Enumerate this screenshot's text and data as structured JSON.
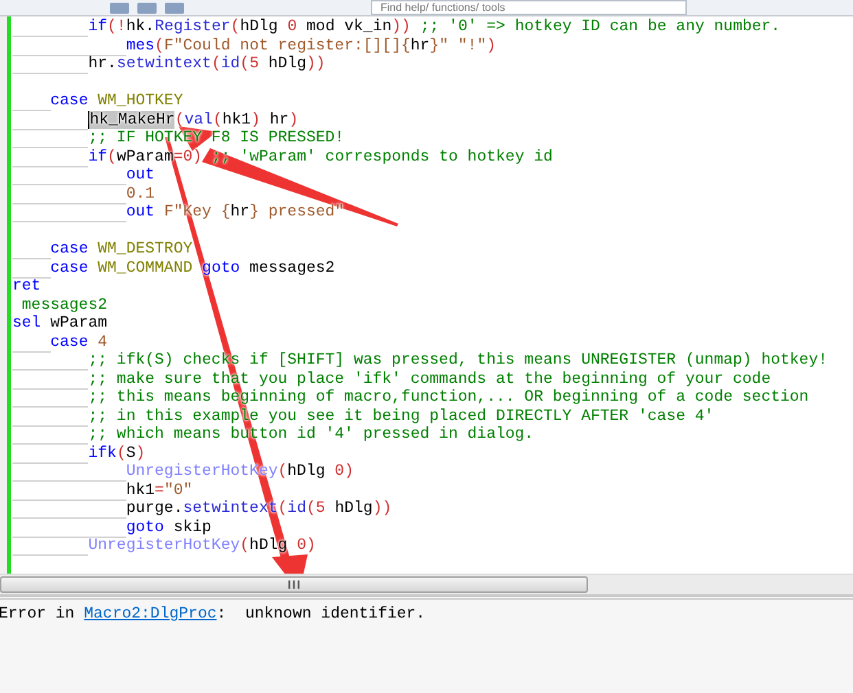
{
  "toolbar": {
    "search": {
      "placeholder": "Find help/ functions/ tools"
    }
  },
  "editor": {
    "lines": [
      {
        "kind": "code",
        "tokens": [
          {
            "text": "\t\tif",
            "kind": "keyword"
          },
          {
            "text": "(!",
            "kind": "op"
          },
          {
            "text": "hk.",
            "kind": "plain"
          },
          {
            "text": "Register",
            "kind": "function"
          },
          {
            "text": "(",
            "kind": "op"
          },
          {
            "text": "hDlg ",
            "kind": "plain"
          },
          {
            "text": "0",
            "kind": "op"
          },
          {
            "text": " mod vk_in",
            "kind": "plain"
          },
          {
            "text": "))",
            "kind": "op"
          },
          {
            "text": " ;; '0' => hotkey ID can be any number.",
            "kind": "comment"
          }
        ]
      },
      {
        "kind": "code",
        "tokens": [
          {
            "text": "\t\t\tmes",
            "kind": "keyword"
          },
          {
            "text": "(",
            "kind": "op"
          },
          {
            "text": "F\"Could not register:[][]{",
            "kind": "string"
          },
          {
            "text": "hr",
            "kind": "plain"
          },
          {
            "text": "}\" \"!\"",
            "kind": "string"
          },
          {
            "text": ")",
            "kind": "op"
          }
        ]
      },
      {
        "kind": "code",
        "tokens": [
          {
            "text": "\t\thr.",
            "kind": "plain"
          },
          {
            "text": "setwintext",
            "kind": "function"
          },
          {
            "text": "(",
            "kind": "op"
          },
          {
            "text": "id",
            "kind": "function"
          },
          {
            "text": "(",
            "kind": "op"
          },
          {
            "text": "5",
            "kind": "op"
          },
          {
            "text": " hDlg",
            "kind": "plain"
          },
          {
            "text": "))",
            "kind": "op"
          }
        ]
      },
      {
        "kind": "blank"
      },
      {
        "kind": "code",
        "tokens": [
          {
            "text": "\tcase",
            "kind": "keyword"
          },
          {
            "text": " WM_HOTKEY",
            "kind": "constant"
          }
        ]
      },
      {
        "kind": "code",
        "tokens": [
          {
            "text": "\t\thk_MakeHr",
            "kind": "selected"
          },
          {
            "text": "(",
            "kind": "op"
          },
          {
            "text": "val",
            "kind": "function"
          },
          {
            "text": "(",
            "kind": "op"
          },
          {
            "text": "hk1",
            "kind": "plain"
          },
          {
            "text": ")",
            "kind": "op"
          },
          {
            "text": " hr",
            "kind": "plain"
          },
          {
            "text": ")",
            "kind": "op"
          }
        ]
      },
      {
        "kind": "code",
        "tokens": [
          {
            "text": "\t\t;; IF HOTKEY F8 IS PRESSED!",
            "kind": "comment"
          }
        ]
      },
      {
        "kind": "code",
        "tokens": [
          {
            "text": "\t\tif",
            "kind": "keyword"
          },
          {
            "text": "(",
            "kind": "op"
          },
          {
            "text": "wParam",
            "kind": "plain"
          },
          {
            "text": "=",
            "kind": "op"
          },
          {
            "text": "0",
            "kind": "op"
          },
          {
            "text": ")",
            "kind": "op"
          },
          {
            "text": " ;; 'wParam' corresponds to hotkey id",
            "kind": "comment"
          }
        ]
      },
      {
        "kind": "code",
        "tokens": [
          {
            "text": "\t\t\tout",
            "kind": "keyword"
          }
        ]
      },
      {
        "kind": "code",
        "tokens": [
          {
            "text": "\t\t\t0.1",
            "kind": "string"
          }
        ]
      },
      {
        "kind": "code",
        "tokens": [
          {
            "text": "\t\t\tout",
            "kind": "keyword"
          },
          {
            "text": " F\"Key {",
            "kind": "string"
          },
          {
            "text": "hr",
            "kind": "plain"
          },
          {
            "text": "} pressed\"",
            "kind": "string"
          }
        ]
      },
      {
        "kind": "blank"
      },
      {
        "kind": "code",
        "tokens": [
          {
            "text": "\tcase",
            "kind": "keyword"
          },
          {
            "text": " WM_DESTROY",
            "kind": "constant"
          }
        ]
      },
      {
        "kind": "code",
        "tokens": [
          {
            "text": "\tcase",
            "kind": "keyword"
          },
          {
            "text": " WM_COMMAND",
            "kind": "constant"
          },
          {
            "text": " goto",
            "kind": "keyword"
          },
          {
            "text": " messages2",
            "kind": "plain"
          }
        ]
      },
      {
        "kind": "code",
        "tokens": [
          {
            "text": "ret",
            "kind": "keyword"
          }
        ]
      },
      {
        "kind": "code",
        "tokens": [
          {
            "text": " messages2",
            "kind": "label"
          }
        ]
      },
      {
        "kind": "code",
        "tokens": [
          {
            "text": "sel",
            "kind": "keyword"
          },
          {
            "text": " wParam",
            "kind": "plain"
          }
        ]
      },
      {
        "kind": "code",
        "tokens": [
          {
            "text": "\tcase",
            "kind": "keyword"
          },
          {
            "text": " 4",
            "kind": "string"
          }
        ]
      },
      {
        "kind": "code",
        "tokens": [
          {
            "text": "\t\t;; ifk(S) checks if [SHIFT] was pressed, this means UNREGISTER (unmap) hotkey!",
            "kind": "comment"
          }
        ]
      },
      {
        "kind": "code",
        "tokens": [
          {
            "text": "\t\t;; make sure that you place 'ifk' commands at the beginning of your code",
            "kind": "comment"
          }
        ]
      },
      {
        "kind": "code",
        "tokens": [
          {
            "text": "\t\t;; this means beginning of macro,function,... OR beginning of a code section",
            "kind": "comment"
          }
        ]
      },
      {
        "kind": "code",
        "tokens": [
          {
            "text": "\t\t;; in this example you see it being placed DIRECTLY AFTER 'case 4'",
            "kind": "comment"
          }
        ]
      },
      {
        "kind": "code",
        "tokens": [
          {
            "text": "\t\t;; which means button id '4' pressed in dialog.",
            "kind": "comment"
          }
        ]
      },
      {
        "kind": "code",
        "tokens": [
          {
            "text": "\t\tifk",
            "kind": "keyword"
          },
          {
            "text": "(",
            "kind": "op"
          },
          {
            "text": "S",
            "kind": "plain"
          },
          {
            "text": ")",
            "kind": "op"
          }
        ]
      },
      {
        "kind": "code",
        "tokens": [
          {
            "text": "\t\t\tUnregisterHotKey",
            "kind": "dll"
          },
          {
            "text": "(",
            "kind": "op"
          },
          {
            "text": "hDlg ",
            "kind": "plain"
          },
          {
            "text": "0",
            "kind": "op"
          },
          {
            "text": ")",
            "kind": "op"
          }
        ]
      },
      {
        "kind": "code",
        "tokens": [
          {
            "text": "\t\t\thk1",
            "kind": "plain"
          },
          {
            "text": "=",
            "kind": "op"
          },
          {
            "text": "\"0\"",
            "kind": "string"
          }
        ]
      },
      {
        "kind": "code",
        "tokens": [
          {
            "text": "\t\t\tpurge.",
            "kind": "plain"
          },
          {
            "text": "setwintext",
            "kind": "function"
          },
          {
            "text": "(",
            "kind": "op"
          },
          {
            "text": "id",
            "kind": "function"
          },
          {
            "text": "(",
            "kind": "op"
          },
          {
            "text": "5",
            "kind": "op"
          },
          {
            "text": " hDlg",
            "kind": "plain"
          },
          {
            "text": "))",
            "kind": "op"
          }
        ]
      },
      {
        "kind": "code",
        "tokens": [
          {
            "text": "\t\t\tgoto",
            "kind": "keyword"
          },
          {
            "text": " skip",
            "kind": "plain"
          }
        ]
      },
      {
        "kind": "code",
        "tokens": [
          {
            "text": "\t\tUnregisterHotKey",
            "kind": "dll"
          },
          {
            "text": "(",
            "kind": "op"
          },
          {
            "text": "hDlg ",
            "kind": "plain"
          },
          {
            "text": "0",
            "kind": "op"
          },
          {
            "text": ")",
            "kind": "op"
          }
        ]
      }
    ]
  },
  "output": {
    "parts": [
      {
        "text": "Error in ",
        "kind": "plain"
      },
      {
        "text": "Macro2:DlgProc",
        "kind": "link"
      },
      {
        "text": ":  unknown identifier.",
        "kind": "plain"
      }
    ]
  }
}
